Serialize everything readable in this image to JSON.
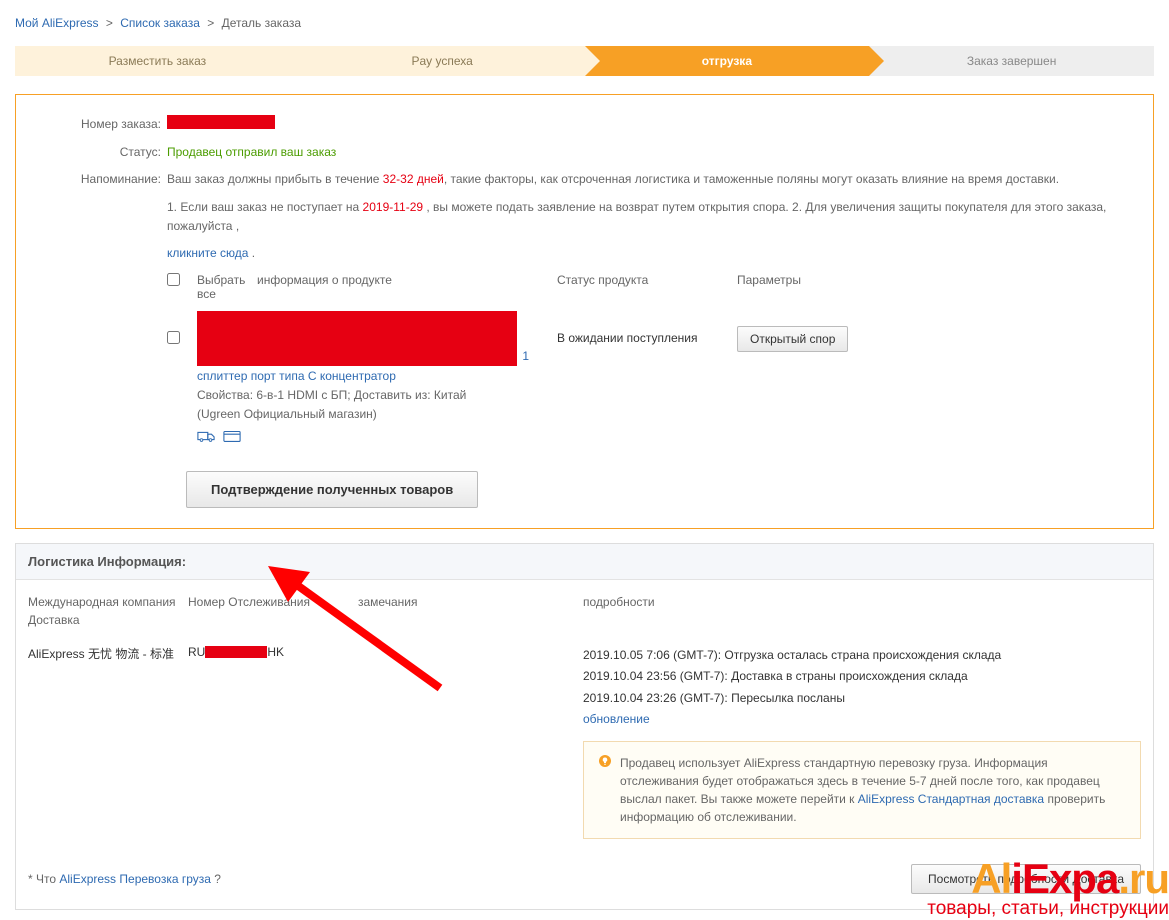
{
  "breadcrumb": {
    "my": "Мой AliExpress",
    "orders": "Список заказа",
    "current": "Деталь заказа"
  },
  "progress": {
    "step1": "Разместить заказ",
    "step2": "Pay успеха",
    "step3": "отгрузка",
    "step4": "Заказ завершен"
  },
  "order": {
    "label_number": "Номер заказа:",
    "label_status": "Статус:",
    "status_value": "Продавец отправил ваш заказ",
    "label_reminder": "Напоминание:",
    "reminder_p1a": "Ваш заказ должны прибыть в течение ",
    "reminder_days": "32-32 дней",
    "reminder_p1b": ", такие факторы, как отсроченная логистика и таможенные поляны могут оказать влияние на время доставки.",
    "reminder_p2a": "1. Если ваш заказ не поступает на ",
    "reminder_date": "2019-11-29",
    "reminder_p2b": " , вы можете подать заявление на возврат путем открытия спора. 2. Для увеличения защиты покупателя для этого заказа, пожалуйста ,",
    "click_here": "кликните сюда",
    "dot": " ."
  },
  "table": {
    "select_all": "Выбрать все",
    "col_info": "информация о продукте",
    "col_status": "Статус продукта",
    "col_params": "Параметры",
    "product_line1": "сплиттер порт типа C концентратор",
    "product_line2": "Свойства: 6-в-1 HDMI с БП; Доставить из: Китай",
    "product_line3": "(Ugreen Официальный магазин)",
    "product_qty": "1",
    "row_status": "В ожидании поступления",
    "btn_dispute": "Открытый спор",
    "btn_confirm": "Подтверждение полученных товаров"
  },
  "logistics": {
    "header": "Логистика Информация:",
    "col1_line1": "Международная компания",
    "col1_line2": "Доставка",
    "col2": "Номер Отслеживания",
    "col3": "замечания",
    "col4": "подробности",
    "company": "AliExpress 无忧 物流 - 标准",
    "tracking_prefix": "RU",
    "tracking_suffix": "HK",
    "events": [
      "2019.10.05 7:06 (GMT-7): Отгрузка осталась страна происхождения склада",
      "2019.10.04 23:56 (GMT-7): Доставка в страны происхождения склада",
      "2019.10.04 23:26 (GMT-7): Пересылка посланы"
    ],
    "update": "обновление",
    "panel_p1": "Продавец использует AliExpress стандартную перевозку груза. Информация отслеживания будет отображаться здесь в течение 5-7 дней после того, как продавец выслал пакет. Вы также можете перейти к ",
    "panel_link": "AliExpress Стандартная доставка",
    "panel_p2": " проверить информацию об отслеживании.",
    "footer_star": "* Что ",
    "footer_link": "AliExpress Перевозка груза",
    "footer_q": " ?",
    "btn_details": "Посмотреть подробности Доставка"
  },
  "watermark": {
    "line1_a": "Al",
    "line1_i": "i",
    "line1_b": "Expa",
    "line1_dot": ".ru",
    "line2": "товары, статьи, инструкции"
  }
}
